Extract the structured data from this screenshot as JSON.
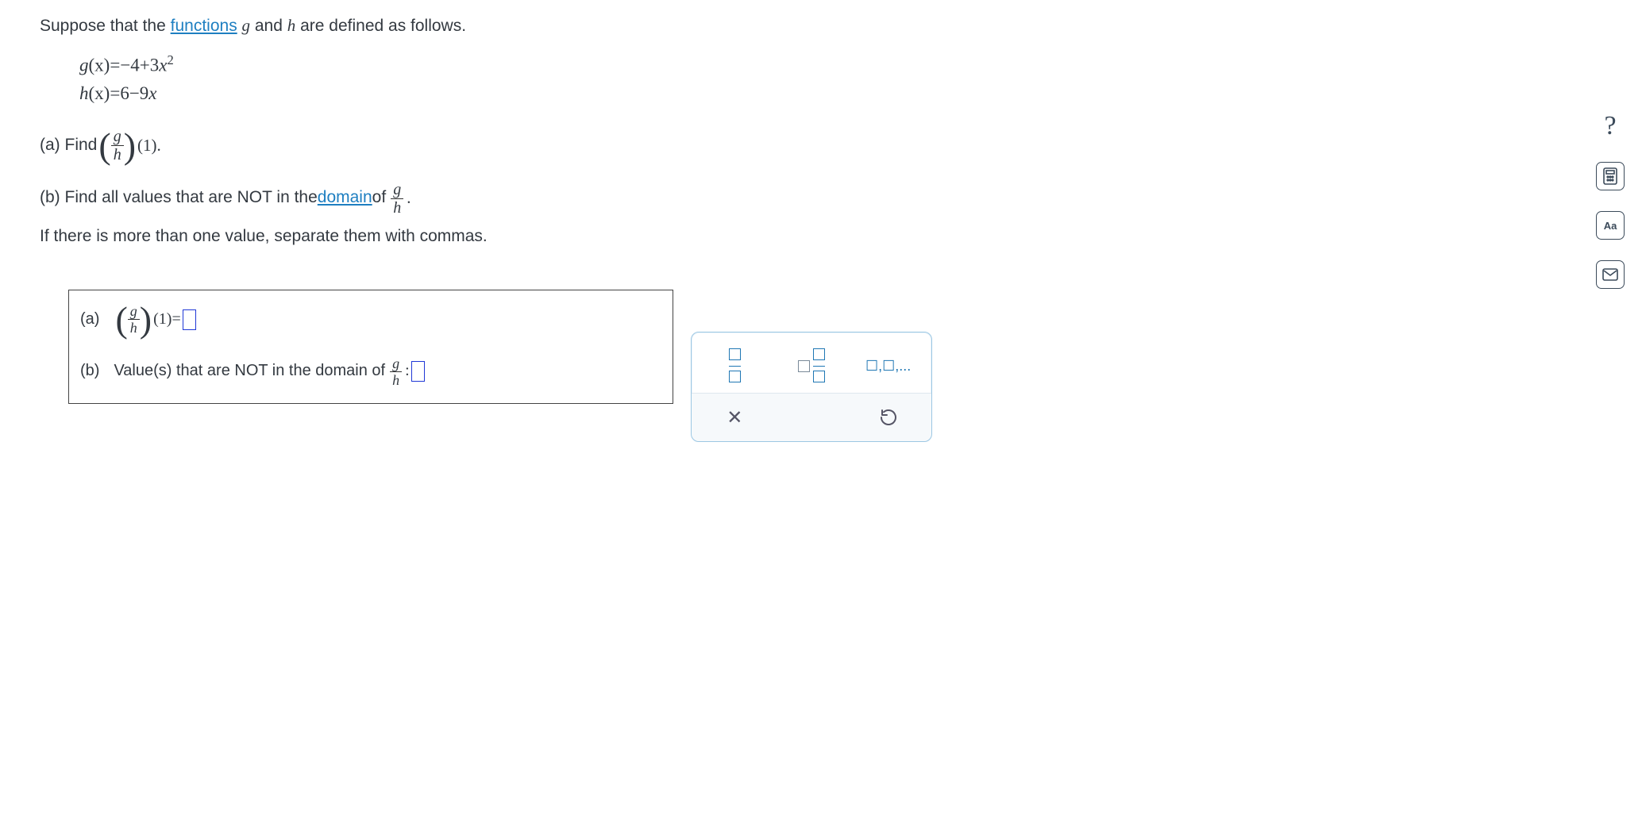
{
  "intro": {
    "prefix": "Suppose that the ",
    "link": "functions",
    "mid": " ",
    "g": "g",
    "and": " and ",
    "h": "h",
    "suffix": " are defined as follows."
  },
  "definitions": {
    "g_lhs_fn": "g",
    "g_lhs_arg": "(x)",
    "g_eq": "=",
    "g_rhs_a": "−4+3",
    "g_rhs_x": "x",
    "g_rhs_exp": "2",
    "h_lhs_fn": "h",
    "h_lhs_arg": "(x)",
    "h_eq": "=",
    "h_rhs": "6−9",
    "h_rhs_x": "x"
  },
  "part_a": {
    "label": "(a) Find ",
    "frac_num": "g",
    "frac_den": "h",
    "arg": "(1).",
    "ans_label": "(a)",
    "ans_arg": "(1)",
    "ans_eq": " = "
  },
  "part_b": {
    "label_pre": "(b) Find all values that are NOT in the ",
    "link": "domain",
    "label_mid": " of ",
    "frac_num": "g",
    "frac_den": "h",
    "period": ".",
    "note": "If there is more than one value, separate them with commas.",
    "ans_label": "(b)",
    "ans_text_pre": "Value(s) that are NOT in the domain of ",
    "ans_colon": " : "
  },
  "keypad": {
    "list_label": "☐,☐,...",
    "clear": "×",
    "reset": "↺"
  },
  "rail": {
    "help": "?",
    "calc": "calc",
    "aa": "Aa",
    "mail": "mail"
  }
}
